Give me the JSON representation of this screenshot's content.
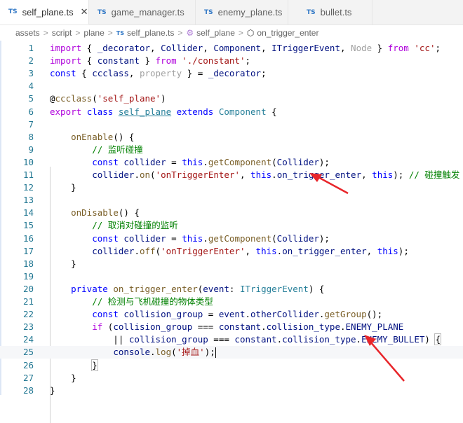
{
  "tabs": [
    {
      "icon": "TS",
      "label": "self_plane.ts",
      "active": true,
      "close": "✕"
    },
    {
      "icon": "TS",
      "label": "game_manager.ts",
      "modified": true
    },
    {
      "icon": "TS",
      "label": "enemy_plane.ts"
    },
    {
      "icon": "TS",
      "label": "bullet.ts"
    }
  ],
  "breadcrumb": [
    "assets",
    "script",
    "plane",
    "self_plane.ts",
    "self_plane",
    "on_trigger_enter"
  ],
  "breadcrumb_ts_icon": "TS",
  "editor": {
    "current_line": 25,
    "lines": [
      {
        "n": "1",
        "tokens": [
          [
            "import",
            "c"
          ],
          [
            " { ",
            "n"
          ],
          [
            "_decorator",
            "v"
          ],
          [
            ", ",
            "n"
          ],
          [
            "Collider",
            "v"
          ],
          [
            ", ",
            "n"
          ],
          [
            "Component",
            "v"
          ],
          [
            ", ",
            "n"
          ],
          [
            "ITriggerEvent",
            "v"
          ],
          [
            ", ",
            "n"
          ],
          [
            "Node",
            "g"
          ],
          [
            " } ",
            "n"
          ],
          [
            "from",
            "c"
          ],
          [
            " ",
            "n"
          ],
          [
            "'cc'",
            "s"
          ],
          [
            ";",
            "n"
          ]
        ]
      },
      {
        "n": "2",
        "tokens": [
          [
            "import",
            "c"
          ],
          [
            " { ",
            "n"
          ],
          [
            "constant",
            "v"
          ],
          [
            " } ",
            "n"
          ],
          [
            "from",
            "c"
          ],
          [
            " ",
            "n"
          ],
          [
            "'./constant'",
            "s"
          ],
          [
            ";",
            "n"
          ]
        ]
      },
      {
        "n": "3",
        "tokens": [
          [
            "const",
            "k"
          ],
          [
            " { ",
            "n"
          ],
          [
            "ccclass",
            "v"
          ],
          [
            ", ",
            "n"
          ],
          [
            "property",
            "g"
          ],
          [
            " } = ",
            "n"
          ],
          [
            "_decorator",
            "v"
          ],
          [
            ";",
            "n"
          ]
        ]
      },
      {
        "n": "4",
        "tokens": []
      },
      {
        "n": "5",
        "tokens": [
          [
            "@",
            "n"
          ],
          [
            "ccclass",
            "f"
          ],
          [
            "(",
            "n"
          ],
          [
            "'self_plane'",
            "s"
          ],
          [
            ")",
            "n"
          ]
        ]
      },
      {
        "n": "6",
        "tokens": [
          [
            "export",
            "c"
          ],
          [
            " ",
            "n"
          ],
          [
            "class",
            "k"
          ],
          [
            " ",
            "n"
          ],
          [
            "self_plane",
            "tu"
          ],
          [
            " ",
            "n"
          ],
          [
            "extends",
            "k"
          ],
          [
            " ",
            "n"
          ],
          [
            "Component",
            "t"
          ],
          [
            " {",
            "n"
          ]
        ]
      },
      {
        "n": "7",
        "tokens": []
      },
      {
        "n": "8",
        "tokens": [
          [
            "    ",
            "n"
          ],
          [
            "onEnable",
            "f"
          ],
          [
            "() {",
            "n"
          ]
        ]
      },
      {
        "n": "9",
        "tokens": [
          [
            "        ",
            "n"
          ],
          [
            "// 监听碰撞",
            "cm"
          ]
        ]
      },
      {
        "n": "10",
        "tokens": [
          [
            "        ",
            "n"
          ],
          [
            "const",
            "k"
          ],
          [
            " ",
            "n"
          ],
          [
            "collider",
            "v"
          ],
          [
            " = ",
            "n"
          ],
          [
            "this",
            "k"
          ],
          [
            ".",
            "n"
          ],
          [
            "getComponent",
            "f"
          ],
          [
            "(",
            "n"
          ],
          [
            "Collider",
            "v"
          ],
          [
            ");",
            "n"
          ]
        ]
      },
      {
        "n": "11",
        "tokens": [
          [
            "        ",
            "n"
          ],
          [
            "collider",
            "v"
          ],
          [
            ".",
            "n"
          ],
          [
            "on",
            "f"
          ],
          [
            "(",
            "n"
          ],
          [
            "'onTriggerEnter'",
            "s"
          ],
          [
            ", ",
            "n"
          ],
          [
            "this",
            "k"
          ],
          [
            ".",
            "n"
          ],
          [
            "on_trigger_enter",
            "v"
          ],
          [
            ", ",
            "n"
          ],
          [
            "this",
            "k"
          ],
          [
            "); ",
            "n"
          ],
          [
            "// 碰撞触发",
            "cm"
          ]
        ]
      },
      {
        "n": "12",
        "tokens": [
          [
            "    }",
            "n"
          ]
        ]
      },
      {
        "n": "13",
        "tokens": []
      },
      {
        "n": "14",
        "tokens": [
          [
            "    ",
            "n"
          ],
          [
            "onDisable",
            "f"
          ],
          [
            "() {",
            "n"
          ]
        ]
      },
      {
        "n": "15",
        "tokens": [
          [
            "        ",
            "n"
          ],
          [
            "// 取消对碰撞的监听",
            "cm"
          ]
        ]
      },
      {
        "n": "16",
        "tokens": [
          [
            "        ",
            "n"
          ],
          [
            "const",
            "k"
          ],
          [
            " ",
            "n"
          ],
          [
            "collider",
            "v"
          ],
          [
            " = ",
            "n"
          ],
          [
            "this",
            "k"
          ],
          [
            ".",
            "n"
          ],
          [
            "getComponent",
            "f"
          ],
          [
            "(",
            "n"
          ],
          [
            "Collider",
            "v"
          ],
          [
            ");",
            "n"
          ]
        ]
      },
      {
        "n": "17",
        "tokens": [
          [
            "        ",
            "n"
          ],
          [
            "collider",
            "v"
          ],
          [
            ".",
            "n"
          ],
          [
            "off",
            "f"
          ],
          [
            "(",
            "n"
          ],
          [
            "'onTriggerEnter'",
            "s"
          ],
          [
            ", ",
            "n"
          ],
          [
            "this",
            "k"
          ],
          [
            ".",
            "n"
          ],
          [
            "on_trigger_enter",
            "v"
          ],
          [
            ", ",
            "n"
          ],
          [
            "this",
            "k"
          ],
          [
            ");",
            "n"
          ]
        ]
      },
      {
        "n": "18",
        "tokens": [
          [
            "    }",
            "n"
          ]
        ]
      },
      {
        "n": "19",
        "tokens": []
      },
      {
        "n": "20",
        "tokens": [
          [
            "    ",
            "n"
          ],
          [
            "private",
            "k"
          ],
          [
            " ",
            "n"
          ],
          [
            "on_trigger_enter",
            "f"
          ],
          [
            "(",
            "n"
          ],
          [
            "event",
            "v"
          ],
          [
            ": ",
            "n"
          ],
          [
            "ITriggerEvent",
            "t"
          ],
          [
            ") {",
            "n"
          ]
        ]
      },
      {
        "n": "21",
        "tokens": [
          [
            "        ",
            "n"
          ],
          [
            "// 检测与飞机碰撞的物体类型",
            "cm"
          ]
        ]
      },
      {
        "n": "22",
        "tokens": [
          [
            "        ",
            "n"
          ],
          [
            "const",
            "k"
          ],
          [
            " ",
            "n"
          ],
          [
            "collision_group",
            "v"
          ],
          [
            " = ",
            "n"
          ],
          [
            "event",
            "v"
          ],
          [
            ".",
            "n"
          ],
          [
            "otherCollider",
            "v"
          ],
          [
            ".",
            "n"
          ],
          [
            "getGroup",
            "f"
          ],
          [
            "();",
            "n"
          ]
        ]
      },
      {
        "n": "23",
        "tokens": [
          [
            "        ",
            "n"
          ],
          [
            "if",
            "c"
          ],
          [
            " (",
            "n"
          ],
          [
            "collision_group",
            "v"
          ],
          [
            " === ",
            "n"
          ],
          [
            "constant",
            "v"
          ],
          [
            ".",
            "n"
          ],
          [
            "collision_type",
            "v"
          ],
          [
            ".",
            "n"
          ],
          [
            "ENEMY_PLANE",
            "v"
          ]
        ]
      },
      {
        "n": "24",
        "tokens": [
          [
            "            || ",
            "n"
          ],
          [
            "collision_group",
            "v"
          ],
          [
            " === ",
            "n"
          ],
          [
            "constant",
            "v"
          ],
          [
            ".",
            "n"
          ],
          [
            "collision_type",
            "v"
          ],
          [
            ".",
            "n"
          ],
          [
            "ENEMY_BULLET",
            "v"
          ],
          [
            ") ",
            "n"
          ],
          [
            "{",
            "nb"
          ]
        ]
      },
      {
        "n": "25",
        "tokens": [
          [
            "            ",
            "n"
          ],
          [
            "console",
            "v"
          ],
          [
            ".",
            "n"
          ],
          [
            "log",
            "f"
          ],
          [
            "(",
            "n"
          ],
          [
            "'掉血'",
            "s"
          ],
          [
            ");",
            "n"
          ],
          [
            "",
            "caret"
          ]
        ]
      },
      {
        "n": "26",
        "tokens": [
          [
            "        ",
            "n"
          ],
          [
            "}",
            "nb"
          ]
        ]
      },
      {
        "n": "27",
        "tokens": [
          [
            "    }",
            "n"
          ]
        ]
      },
      {
        "n": "28",
        "tokens": [
          [
            "}",
            "n"
          ]
        ]
      }
    ]
  },
  "colors": {
    "annotation_arrow": "#e8252a",
    "ts_icon": "#3178c6"
  }
}
